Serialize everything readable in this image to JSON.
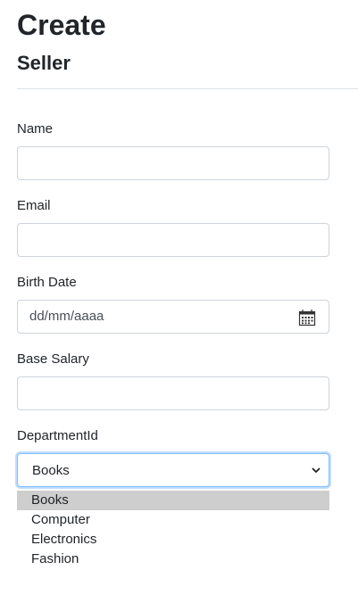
{
  "header": {
    "title": "Create",
    "subtitle": "Seller"
  },
  "form": {
    "name": {
      "label": "Name",
      "value": ""
    },
    "email": {
      "label": "Email",
      "value": ""
    },
    "birth_date": {
      "label": "Birth Date",
      "placeholder": "dd/mm/aaaa",
      "icon": "calendar-icon"
    },
    "base_salary": {
      "label": "Base Salary",
      "value": ""
    },
    "department": {
      "label": "DepartmentId",
      "selected": "Books",
      "options": [
        "Books",
        "Computer",
        "Electronics",
        "Fashion"
      ],
      "icon": "chevron-down-icon"
    }
  },
  "colors": {
    "focus_border": "#80bdff",
    "highlight": "#cecece",
    "input_border": "#ced4da"
  }
}
